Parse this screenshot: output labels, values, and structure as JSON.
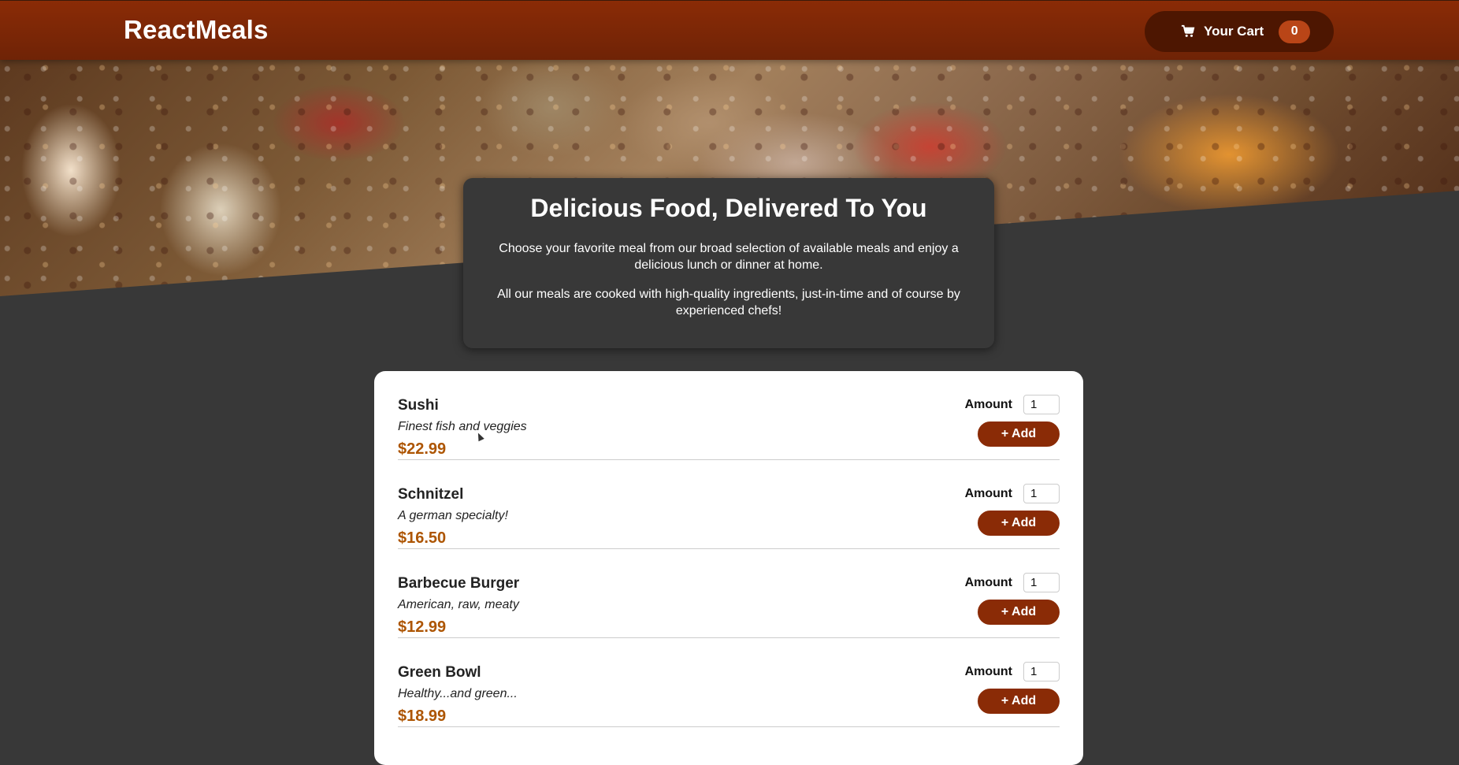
{
  "header": {
    "logo": "ReactMeals",
    "cart": {
      "label": "Your Cart",
      "count": "0",
      "icon": "cart-icon"
    }
  },
  "summary": {
    "title": "Delicious Food, Delivered To You",
    "paragraph1": "Choose your favorite meal from our broad selection of available meals and enjoy a delicious lunch or dinner at home.",
    "paragraph2": "All our meals are cooked with high-quality ingredients, just-in-time and of course by experienced chefs!"
  },
  "meals": [
    {
      "name": "Sushi",
      "description": "Finest fish and veggies",
      "price": "$22.99",
      "amount_label": "Amount",
      "amount": "1",
      "add_label": "+ Add"
    },
    {
      "name": "Schnitzel",
      "description": "A german specialty!",
      "price": "$16.50",
      "amount_label": "Amount",
      "amount": "1",
      "add_label": "+ Add"
    },
    {
      "name": "Barbecue Burger",
      "description": "American, raw, meaty",
      "price": "$12.99",
      "amount_label": "Amount",
      "amount": "1",
      "add_label": "+ Add"
    },
    {
      "name": "Green Bowl",
      "description": "Healthy...and green...",
      "price": "$18.99",
      "amount_label": "Amount",
      "amount": "1",
      "add_label": "+ Add"
    }
  ],
  "colors": {
    "header": "#8a2b06",
    "cart_button": "#4d1601",
    "badge": "#b94517",
    "price": "#ad5502",
    "background": "#383838"
  }
}
